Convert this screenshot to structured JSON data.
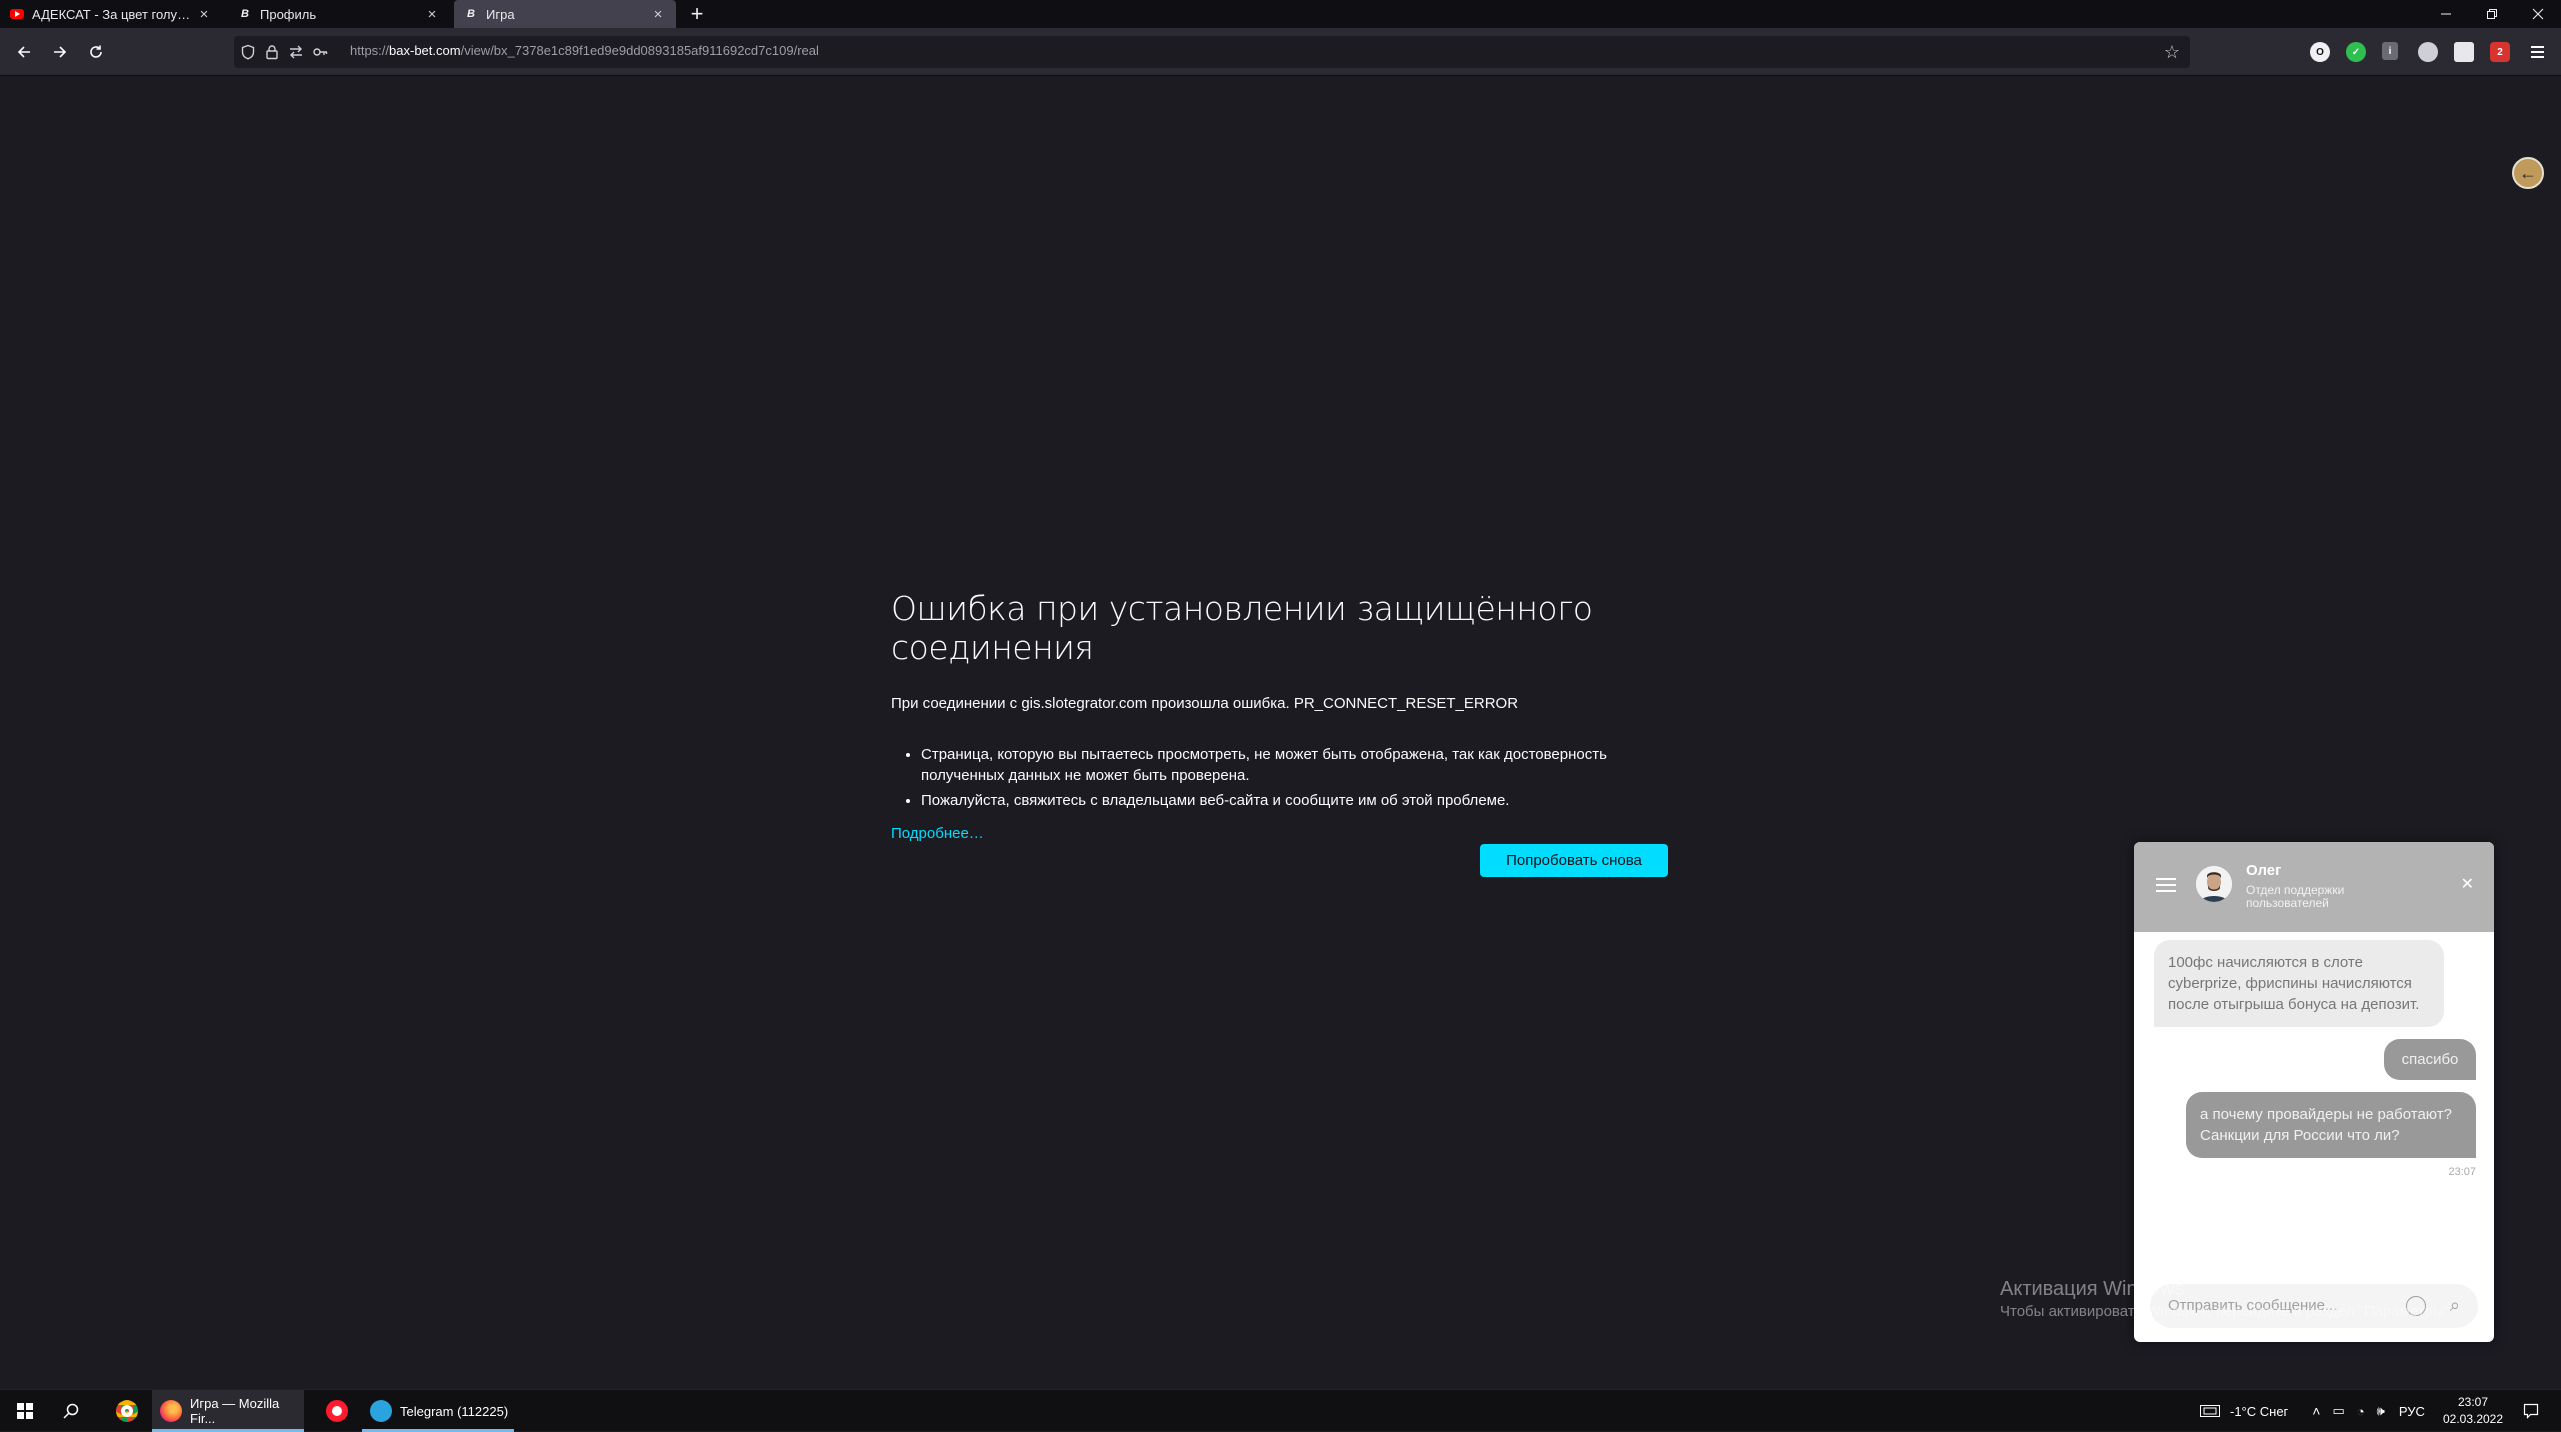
{
  "browser": {
    "tabs": [
      {
        "label": "АДЕКСАТ - За цвет голубых о",
        "favicon": "youtube-icon",
        "active": false
      },
      {
        "label": "Профиль",
        "favicon": "site-icon",
        "active": false
      },
      {
        "label": "Игра",
        "favicon": "site-icon",
        "active": true
      }
    ],
    "new_tab": "+",
    "url": {
      "scheme": "https://",
      "host": "bax-bet.com",
      "path": "/view/bx_7378e1c89f1ed9e9dd0893185af911692cd7c109/real"
    },
    "extension_badge": "2"
  },
  "error": {
    "title": "Ошибка при установлении защищённого соединения",
    "description": "При соединении с gis.slotegrator.com произошла ошибка. PR_CONNECT_RESET_ERROR",
    "bullets": [
      "Страница, которую вы пытаетесь просмотреть, не может быть отображена, так как достоверность полученных данных не может быть проверена.",
      "Пожалуйста, свяжитесь с владельцами веб-сайта и сообщите им об этой проблеме."
    ],
    "learn_more": "Подробнее…",
    "retry_label": "Попробовать снова"
  },
  "chat": {
    "agent_name": "Олег",
    "agent_role": "Отдел поддержки пользователей",
    "messages": [
      {
        "from": "agent",
        "text": "100фс начисляются в слоте cyberprize, фриспины начисляются после отыгрыша бонуса на депозит."
      },
      {
        "from": "user",
        "text": "спасибо"
      },
      {
        "from": "user",
        "text": "а почему провайдеры не работают? Санкции для России что ли?",
        "time": "23:07"
      }
    ],
    "input_placeholder": "Отправить сообщение..."
  },
  "watermark": {
    "line1": "Активация Windows",
    "line2": "Чтобы активировать Windows, перейдите в раздел \"Параметры\"."
  },
  "taskbar": {
    "apps": [
      {
        "label": "Игра — Mozilla Fir...",
        "icon": "firefox-icon"
      },
      {
        "label": "Telegram (112225)",
        "icon": "telegram-icon"
      }
    ],
    "weather": "-1°C  Снег",
    "language": "РУС",
    "time": "23:07",
    "date": "02.03.2022"
  }
}
